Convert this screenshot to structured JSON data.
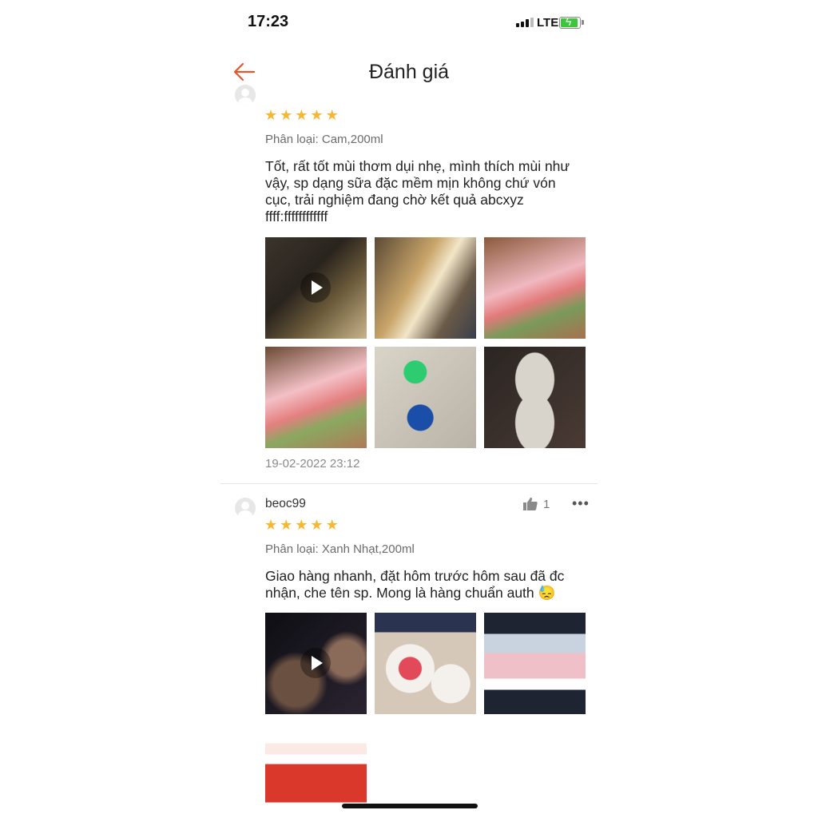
{
  "status": {
    "time": "17:23",
    "network": "LTE"
  },
  "header": {
    "title": "Đánh giá",
    "back_icon": "back-arrow-icon",
    "accent": "#e4572e"
  },
  "reviews": [
    {
      "username": "",
      "rating": 5,
      "stars": [
        "★",
        "★",
        "★",
        "★",
        "★"
      ],
      "variant": "Phân loại: Cam,200ml",
      "text": "Tốt, rất tốt mùi thơm dụi nhẹ, mình thích mùi như vậy, sp dạng  sữa đặc mềm mịn không chứ vón cục, trải nghiệm đang chờ kết quả abcxyz ffff:ffffffffffff",
      "date": "19-02-2022 23:12"
    },
    {
      "username": "beoc99",
      "likes": "1",
      "more": "•••",
      "rating": 5,
      "stars": [
        "★",
        "★",
        "★",
        "★",
        "★"
      ],
      "variant": "Phân loại: Xanh Nhạt,200ml",
      "text": "Giao hàng nhanh, đặt hôm trước hôm sau đã đc nhận, che tên sp. Mong là hàng chuẩn auth 😓"
    }
  ],
  "colors": {
    "star": "#f7b731",
    "secondary_text": "#8a8a8a",
    "battery": "#3cc63c"
  }
}
